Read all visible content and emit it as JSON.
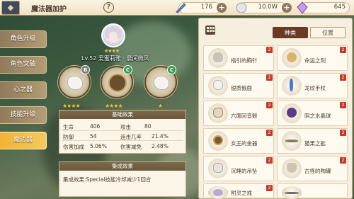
{
  "header": {
    "back_icon": "diamond-back-icon",
    "title": "魔法器加护",
    "help_label": "?",
    "resources": [
      {
        "icon": "feather-quill-icon",
        "value": "176"
      },
      {
        "icon": "silver-orb-icon",
        "value": "10.0W"
      },
      {
        "icon": "crystal-gem-icon",
        "value": "645"
      }
    ],
    "plus_label": "+"
  },
  "menu": {
    "items": [
      {
        "label": "角色升级",
        "active": false
      },
      {
        "label": "角色突破",
        "active": false
      },
      {
        "label": "心之器",
        "active": false
      },
      {
        "label": "技能升级",
        "active": false
      },
      {
        "label": "魔法器",
        "active": true
      }
    ]
  },
  "character": {
    "stars": "★★★★",
    "name_line": "Lv.52  爱蜜莉雅 · 晨间微风"
  },
  "slots": [
    {
      "grade": "B",
      "stars": "★★★★",
      "icon": "white-mask-icon"
    },
    {
      "grade": "C",
      "stars": "★★★★",
      "icon": "bronze-medallion-icon"
    },
    {
      "grade": "C",
      "stars": "★",
      "icon": "white-mask-icon"
    }
  ],
  "base_effects": {
    "title": "基础效果",
    "rows": [
      [
        {
          "label": "生命",
          "value": "406"
        },
        {
          "label": "攻击",
          "value": "80"
        }
      ],
      [
        {
          "label": "防御",
          "value": "54"
        },
        {
          "label": "连击几率",
          "value": "21.4%"
        }
      ],
      [
        {
          "label": "伤害加成",
          "value": "5.06%"
        },
        {
          "label": "伤害减免",
          "value": "2.48%"
        }
      ]
    ]
  },
  "set_effects": {
    "title": "集成效果",
    "text": "集成效果:Special技能冷却减少1回合"
  },
  "inventory": {
    "grid_icon": "grid-view-icon",
    "tabs": [
      {
        "label": "种类",
        "selected": true
      },
      {
        "label": "位置",
        "selected": false
      }
    ],
    "items": [
      {
        "name": "指引的胸针",
        "count": "2",
        "icon": "silver-brooch-icon",
        "color": "#c9c2b8"
      },
      {
        "name": "命运之刻",
        "count": "2",
        "icon": "pocket-watch-icon",
        "color": "#d8b46a"
      },
      {
        "name": "银质假面",
        "count": "2",
        "icon": "silver-mask-icon",
        "color": "#f2f0ec"
      },
      {
        "name": "龙纹手杖",
        "count": "2",
        "icon": "dragon-staff-icon",
        "color": "#4a78c8"
      },
      {
        "name": "六面回音骰",
        "count": "2",
        "icon": "dice-icon",
        "color": "#e4d6be"
      },
      {
        "name": "阴之水晶球",
        "count": "2",
        "icon": "crystal-ball-icon",
        "color": "#5a3a8a"
      },
      {
        "name": "女王的金器",
        "count": "2",
        "icon": "gold-medallion-icon",
        "color": "#7a5a32"
      },
      {
        "name": "猫果之匙",
        "count": "2",
        "icon": "key-icon",
        "color": "#8a7a62"
      },
      {
        "name": "沉睡的吊坠",
        "count": "2",
        "icon": "pendant-icon",
        "color": "#e9e4dc"
      },
      {
        "name": "古怪的陶罐",
        "count": "2",
        "icon": "pottery-jar-icon",
        "color": "#cfc3ae"
      },
      {
        "name": "附灵之戒",
        "count": "2",
        "icon": "ring-icon",
        "color": "#b8a8d8"
      },
      {
        "name": "",
        "count": "",
        "icon": "sword-icon",
        "color": "#6a6a6a"
      }
    ]
  }
}
